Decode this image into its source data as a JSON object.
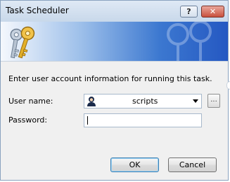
{
  "window": {
    "title": "Task Scheduler",
    "help_glyph": "?",
    "close_glyph": "✕"
  },
  "banner": {
    "icon": "keys-icon"
  },
  "form": {
    "instruction": "Enter user account information for running this task.",
    "user_label": "User name:",
    "user_value": "scripts",
    "password_label": "Password:",
    "password_value": "",
    "browse_label": "..."
  },
  "buttons": {
    "ok_label": "OK",
    "cancel_label": "Cancel"
  },
  "colors": {
    "banner_start": "#f5f8fd",
    "banner_end": "#2558c2",
    "key_gold": "#e3b02a",
    "key_silver": "#b8c4d2"
  }
}
